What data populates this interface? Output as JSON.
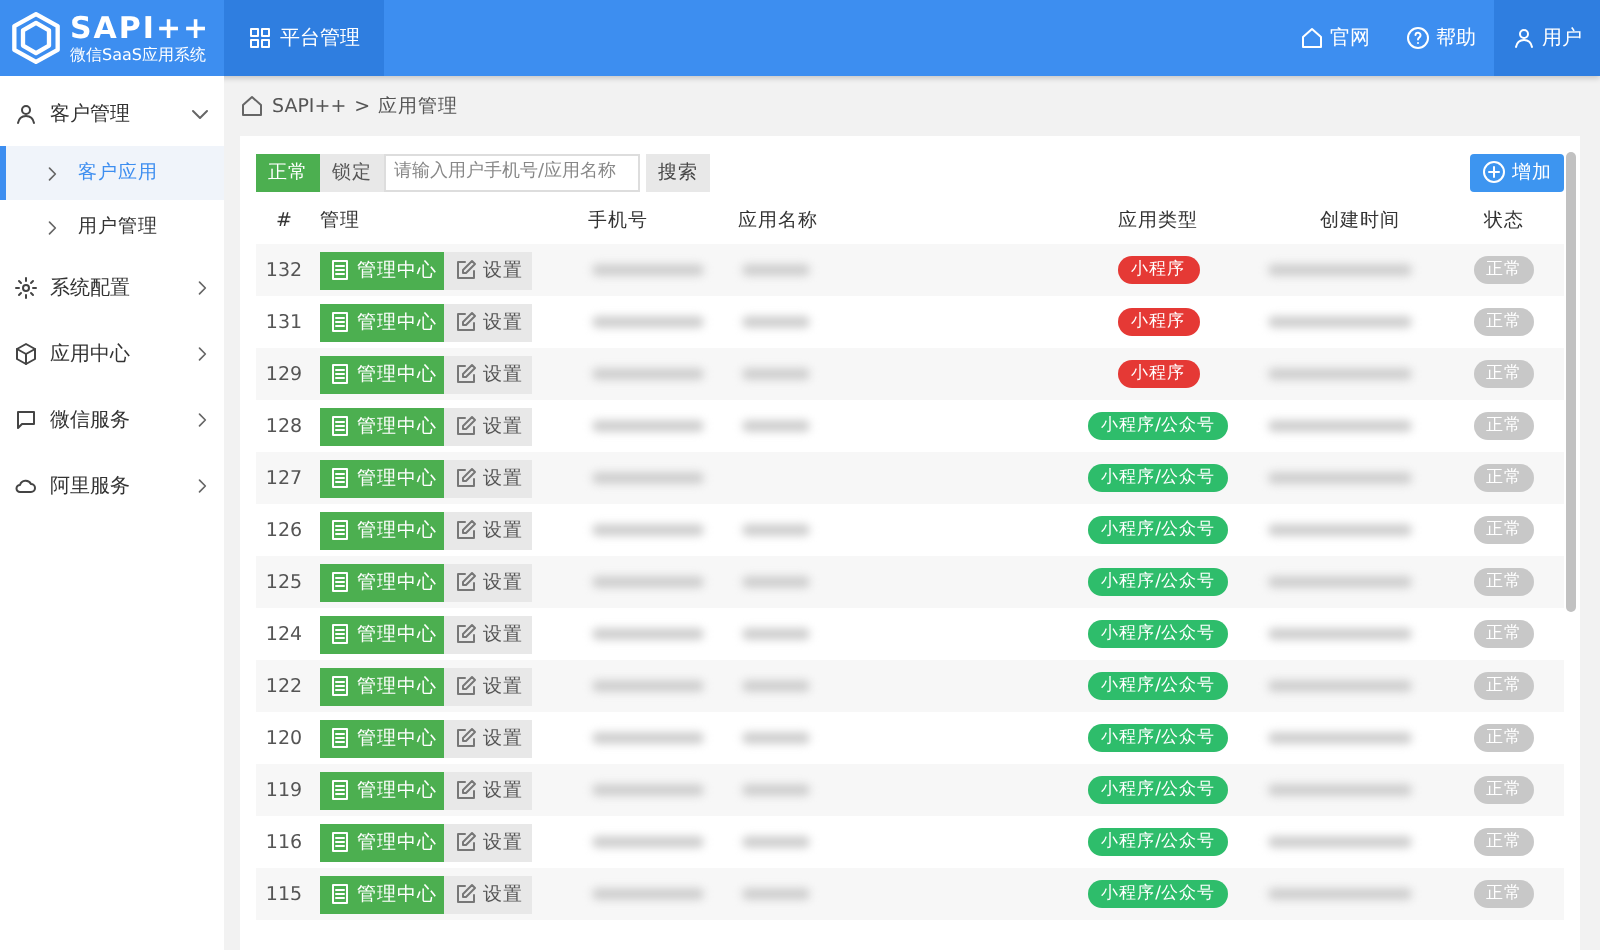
{
  "header": {
    "logo_title": "SAPI++",
    "logo_subtitle": "微信SaaS应用系统",
    "nav": [
      {
        "label": "平台管理",
        "selected": true
      }
    ],
    "links": [
      {
        "label": "官网",
        "kind": "home"
      },
      {
        "label": "帮助",
        "kind": "help"
      },
      {
        "label": "用户",
        "kind": "user"
      }
    ]
  },
  "sidebar": {
    "items": [
      {
        "label": "客户管理",
        "kind": "user",
        "expanded": true,
        "children": [
          {
            "label": "客户应用",
            "selected": true
          },
          {
            "label": "用户管理",
            "selected": false
          }
        ]
      },
      {
        "label": "系统配置",
        "kind": "gear",
        "expanded": false
      },
      {
        "label": "应用中心",
        "kind": "cube",
        "expanded": false
      },
      {
        "label": "微信服务",
        "kind": "chat",
        "expanded": false
      },
      {
        "label": "阿里服务",
        "kind": "cloud",
        "expanded": false
      }
    ]
  },
  "breadcrumb": {
    "separator": ">",
    "items": [
      "SAPI++",
      "应用管理"
    ]
  },
  "toolbar": {
    "filters": [
      {
        "label": "正常",
        "selected": true
      },
      {
        "label": "锁定",
        "selected": false
      }
    ],
    "search": {
      "placeholder": "请输入用户手机号/应用名称"
    },
    "search_button": "搜索",
    "add_button": "增加"
  },
  "table": {
    "columns": [
      "#",
      "管理",
      "手机号",
      "应用名称",
      "应用类型",
      "创建时间",
      "状态"
    ],
    "rows": [
      {
        "id": "132",
        "manage": "管理中心",
        "settings": "设置",
        "type": "小程序",
        "color": "#e53935",
        "status": "正常"
      },
      {
        "id": "131",
        "manage": "管理中心",
        "settings": "设置",
        "type": "小程序",
        "color": "#e53935",
        "status": "正常"
      },
      {
        "id": "129",
        "manage": "管理中心",
        "settings": "设置",
        "type": "小程序",
        "color": "#e53935",
        "status": "正常"
      },
      {
        "id": "128",
        "manage": "管理中心",
        "settings": "设置",
        "type": "小程序/公众号",
        "color": "#2ebd6b",
        "status": "正常"
      },
      {
        "id": "127",
        "manage": "管理中心",
        "settings": "设置",
        "type": "小程序/公众号",
        "color": "#2ebd6b",
        "status": "正常"
      },
      {
        "id": "126",
        "manage": "管理中心",
        "settings": "设置",
        "type": "小程序/公众号",
        "color": "#2ebd6b",
        "status": "正常"
      },
      {
        "id": "125",
        "manage": "管理中心",
        "settings": "设置",
        "type": "小程序/公众号",
        "color": "#2ebd6b",
        "status": "正常"
      },
      {
        "id": "124",
        "manage": "管理中心",
        "settings": "设置",
        "type": "小程序/公众号",
        "color": "#2ebd6b",
        "status": "正常"
      },
      {
        "id": "122",
        "manage": "管理中心",
        "settings": "设置",
        "type": "小程序/公众号",
        "color": "#2ebd6b",
        "status": "正常"
      },
      {
        "id": "120",
        "manage": "管理中心",
        "settings": "设置",
        "type": "小程序/公众号",
        "color": "#2ebd6b",
        "status": "正常"
      },
      {
        "id": "119",
        "manage": "管理中心",
        "settings": "设置",
        "type": "小程序/公众号",
        "color": "#2ebd6b",
        "status": "正常"
      },
      {
        "id": "116",
        "manage": "管理中心",
        "settings": "设置",
        "type": "小程序/公众号",
        "color": "#2ebd6b",
        "status": "正常"
      },
      {
        "id": "115",
        "manage": "管理中心",
        "settings": "设置",
        "type": "小程序/公众号",
        "color": "#2ebd6b",
        "status": "正常"
      }
    ]
  }
}
